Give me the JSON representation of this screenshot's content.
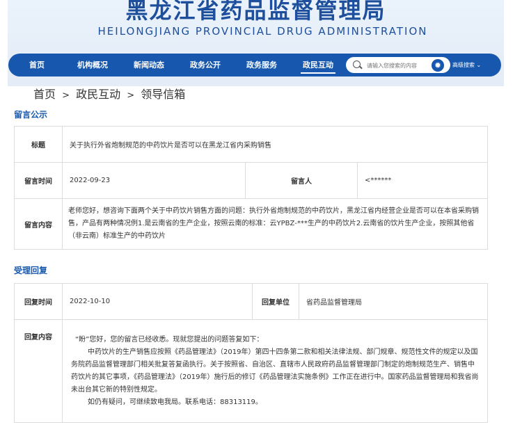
{
  "header": {
    "title_cn": "黑龙江省药品监督管理局",
    "title_en": "HEILONGJIANG PROVINCIAL DRUG ADMINISTRATION"
  },
  "nav": {
    "items": [
      "首页",
      "机构概况",
      "新闻动态",
      "政务公开",
      "政务服务",
      "政民互动"
    ],
    "active_index": 5,
    "search_placeholder": "请输入您搜索的内容",
    "advanced_search": "高级搜索",
    "chevron": "⌄"
  },
  "breadcrumb": {
    "items": [
      "首页",
      "政民互动",
      "领导信箱"
    ],
    "separator": ">"
  },
  "message_section": {
    "title": "留言公示",
    "subject_label": "标题",
    "subject": "关于执行外省炮制规范的中药饮片是否可以在黑龙江省内采购销售",
    "time_label": "留言时间",
    "time": "2022-09-23",
    "person_label": "留言人",
    "person": "<******",
    "content_label": "留言内容",
    "content": "老师您好，想咨询下面两个关于中药饮片销售方面的问题：执行外省炮制规范的中药饮片，黑龙江省内经营企业是否可以在本省采购销售，产品有两种情况例1.是云南省的生产企业，按照云南的标准：云YPBZ-***生产的中药饮片2.云南省的饮片生产企业，按照其他省（非云南）标准生产的中药饮片"
  },
  "reply_section": {
    "title": "受理回复",
    "time_label": "回复时间",
    "time": "2022-10-10",
    "unit_label": "回复单位",
    "unit": "省药品监督管理局",
    "content_label": "回复内容",
    "lines": [
      "“盼”您好，您的留言已经收悉。现就您提出的问题答复如下：",
      "中药饮片的生产销售应按照《药品管理法》（2019年）第四十四条第二款和相关法律法规、部门规章、规范性文件的规定以及国务院药品监督管理部门相关批复答复函执行。关于按照省、自治区、直辖市人民政府药品监督管理部门制定的炮制规范生产、销售中药饮片的其它事项，《药品管理法》（2019年）施行后的修订《药品管理法实施条例》工作正在进行中。国家药品监督管理局和我省尚未出台其它新的特别性规定。",
      "如仍有疑问，可继续致电我局。联系电话：88313119。"
    ]
  }
}
